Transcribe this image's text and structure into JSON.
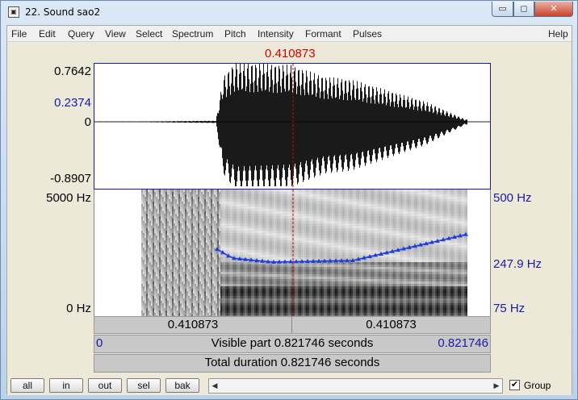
{
  "window": {
    "title": "22. Sound sao2",
    "app_icon": "praat-app-icon"
  },
  "window_buttons": {
    "minimize": "▭",
    "maximize": "◻",
    "close": "✕"
  },
  "menu": [
    "File",
    "Edit",
    "Query",
    "View",
    "Select",
    "Spectrum",
    "Pitch",
    "Intensity",
    "Formant",
    "Pulses",
    "Help"
  ],
  "cursor": {
    "time": "0.410873",
    "color": "#d40000"
  },
  "waveform": {
    "ymax": "0.7642",
    "ysel": "0.2374",
    "yzero": "0",
    "ymin": "-0.8907"
  },
  "spectrogram": {
    "freq_top": "5000 Hz",
    "freq_bottom": "0 Hz",
    "pitch_top": "500 Hz",
    "pitch_mid": "247.9 Hz",
    "pitch_bottom": "75 Hz",
    "pitch_color": "#1f3fd6"
  },
  "time_bar": {
    "left": "0.410873",
    "right": "0.410873"
  },
  "visible_bar": {
    "start": "0",
    "text": "Visible part 0.821746 seconds",
    "end": "0.821746"
  },
  "total_bar": {
    "text": "Total duration 0.821746 seconds"
  },
  "bottom": {
    "buttons": [
      "all",
      "in",
      "out",
      "sel",
      "bak"
    ],
    "group_checked": "✔",
    "group_label": "Group"
  }
}
